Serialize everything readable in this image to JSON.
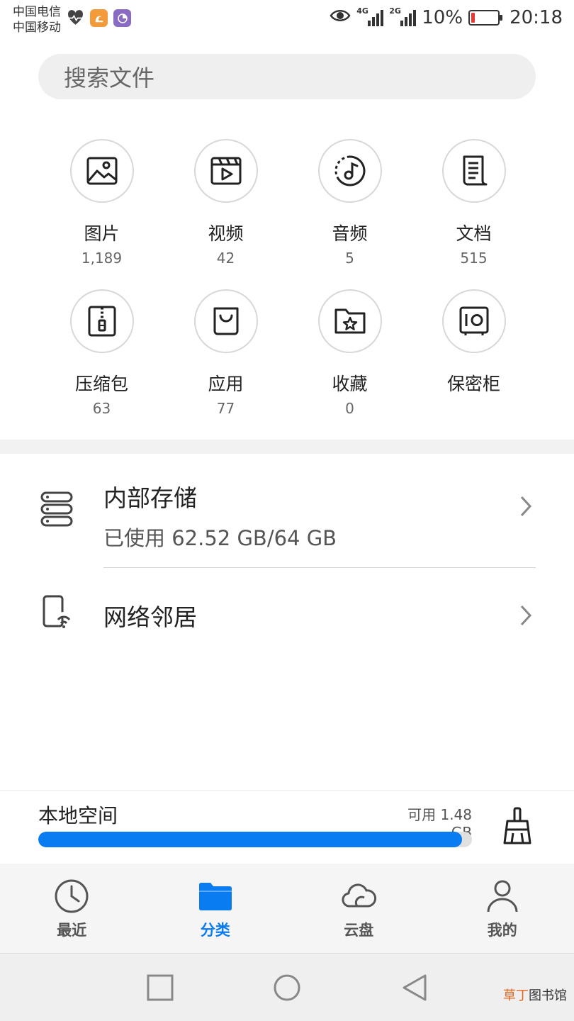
{
  "status_bar": {
    "carrier1": "中国电信",
    "carrier2": "中国移动",
    "net1": "4G",
    "net2": "2G",
    "battery": "10%",
    "time": "20:18",
    "app_icons": [
      "heart-rate-icon",
      "uc-browser-icon",
      "app-icon"
    ]
  },
  "search": {
    "placeholder": "搜索文件"
  },
  "categories": [
    {
      "label": "图片",
      "count": "1,189",
      "icon": "image-icon"
    },
    {
      "label": "视频",
      "count": "42",
      "icon": "video-icon"
    },
    {
      "label": "音频",
      "count": "5",
      "icon": "audio-icon"
    },
    {
      "label": "文档",
      "count": "515",
      "icon": "document-icon"
    },
    {
      "label": "压缩包",
      "count": "63",
      "icon": "archive-icon"
    },
    {
      "label": "应用",
      "count": "77",
      "icon": "app-bag-icon"
    },
    {
      "label": "收藏",
      "count": "0",
      "icon": "favorite-folder-icon"
    },
    {
      "label": "保密柜",
      "count": "",
      "icon": "safe-icon"
    }
  ],
  "storage": {
    "internal_title": "内部存储",
    "internal_usage": "已使用 62.52 GB/64 GB",
    "network_title": "网络邻居"
  },
  "local_space": {
    "title": "本地空间",
    "available": "可用 1.48 GB",
    "used_fraction": 0.977
  },
  "tabs": [
    {
      "label": "最近",
      "icon": "clock-icon",
      "active": false
    },
    {
      "label": "分类",
      "icon": "folder-icon",
      "active": true
    },
    {
      "label": "云盘",
      "icon": "cloud-icon",
      "active": false
    },
    {
      "label": "我的",
      "icon": "person-icon",
      "active": false
    }
  ],
  "watermark": {
    "part1": "草丁",
    "part2": "图书馆"
  },
  "colors": {
    "accent": "#0a7cf2",
    "battery_low": "#e53935"
  }
}
